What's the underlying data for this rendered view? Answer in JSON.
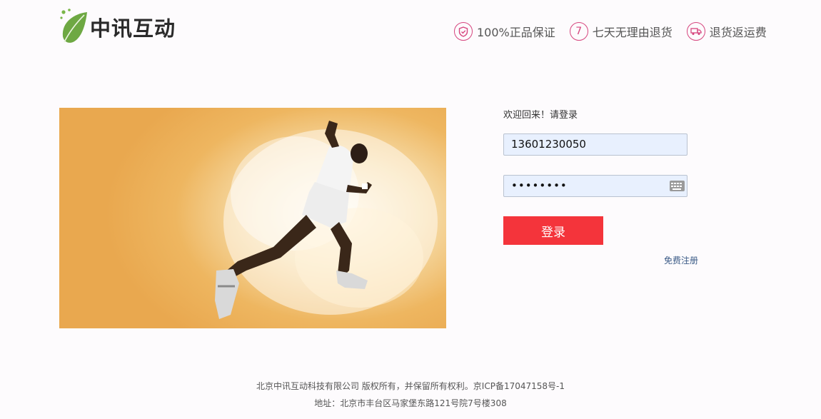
{
  "header": {
    "logo_text": "中讯互动",
    "promises": [
      {
        "icon": "shield-icon",
        "glyph": "",
        "label": "100%正品保证"
      },
      {
        "icon": "seven-days-icon",
        "glyph": "7",
        "label": "七天无理由退货"
      },
      {
        "icon": "truck-icon",
        "glyph": "",
        "label": "退货返运费"
      }
    ]
  },
  "login": {
    "welcome": "欢迎回来！请登录",
    "username_value": "13601230050",
    "password_value": "••••••••",
    "submit_label": "登录",
    "register_label": "免费注册"
  },
  "footer": {
    "line1": "北京中讯互动科技有限公司 版权所有，并保留所有权利。京ICP备17047158号-1",
    "line2": "地址：北京市丰台区马家堡东路121号院7号楼308"
  },
  "colors": {
    "accent": "#f4343b",
    "promise_pink": "#d6457e",
    "logo_green": "#6ea843",
    "banner_orange": "#e9a84f"
  }
}
